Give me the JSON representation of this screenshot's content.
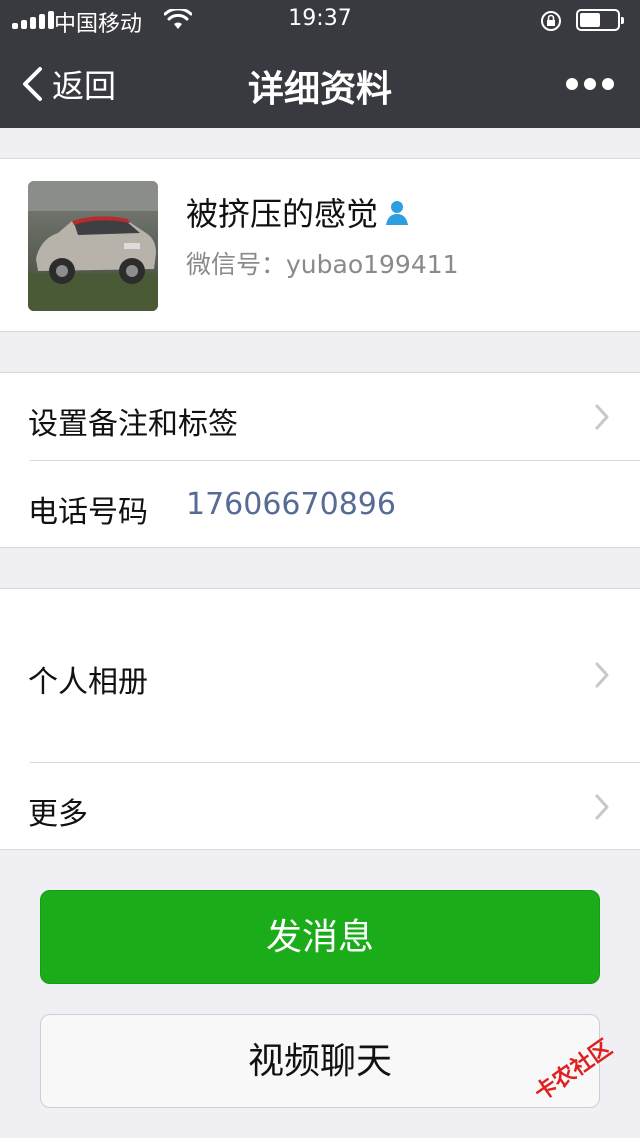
{
  "status_bar": {
    "carrier": "中国移动",
    "time": "19:37"
  },
  "navbar": {
    "back_label": "返回",
    "title": "详细资料",
    "more_icon": "ellipsis-icon"
  },
  "profile": {
    "name": "被挤压的感觉",
    "wechat_id": "微信号：yubao199411",
    "avatar": "car-photo-avatar",
    "badge_icon": "contact-person-icon"
  },
  "rows": {
    "remark": {
      "label": "设置备注和标签"
    },
    "phone": {
      "label": "电话号码",
      "value": "17606670896"
    },
    "album": {
      "label": "个人相册"
    },
    "more": {
      "label": "更多"
    }
  },
  "buttons": {
    "send_message": "发消息",
    "video_chat": "视频聊天"
  },
  "watermark": {
    "text": "卡农社区"
  },
  "colors": {
    "navbar_bg": "#393a3f",
    "page_bg": "#efeff4",
    "primary_green": "#1aad19",
    "link_blue": "#576b95"
  }
}
